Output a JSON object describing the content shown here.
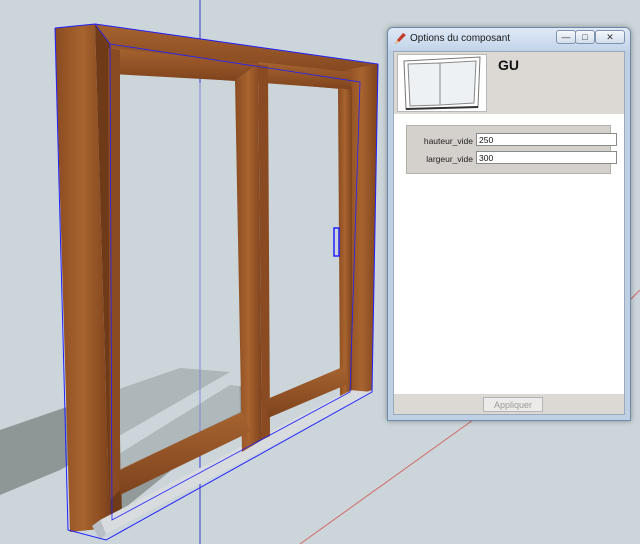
{
  "dialog": {
    "title": "Options du composant",
    "component_name": "GU",
    "attributes": [
      {
        "label": "hauteur_vide",
        "value": "250"
      },
      {
        "label": "largeur_vide",
        "value": "300"
      }
    ],
    "apply_label": "Appliquer",
    "window_buttons": {
      "minimize": "—",
      "maximize": "□",
      "close": "✕"
    }
  },
  "colors": {
    "viewport_bg": "#ccd6da",
    "wood": "#9c5a2c",
    "wood_dark": "#6f3a17",
    "selection": "#2020ff",
    "shadow": "#8f9696"
  }
}
